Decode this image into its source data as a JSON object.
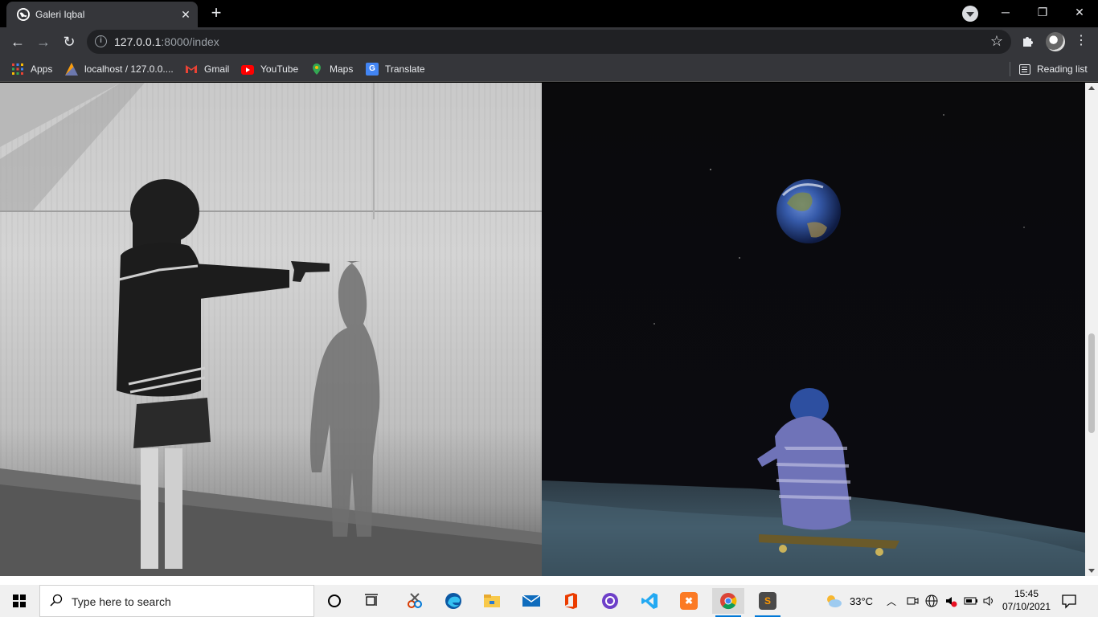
{
  "browser": {
    "tab_title": "Galeri Iqbal",
    "url_host": "127.0.0.1",
    "url_rest": ":8000/index",
    "window_controls": [
      "minimize",
      "restore",
      "close"
    ]
  },
  "bookmarks": {
    "apps": "Apps",
    "items": [
      "localhost / 127.0.0....",
      "Gmail",
      "YouTube",
      "Maps",
      "Translate"
    ],
    "reading_list": "Reading list"
  },
  "page": {
    "images": [
      {
        "name": "girl-with-gun-shadow-photo",
        "tone": "grayscale"
      },
      {
        "name": "boy-on-moon-earth-photo",
        "tone": "color"
      }
    ]
  },
  "taskbar": {
    "search_placeholder": "Type here to search",
    "weather_temp": "33°C",
    "time": "15:45",
    "date": "07/10/2021"
  },
  "colors": {
    "chrome_dark": "#35363a",
    "omnibox": "#202124",
    "taskbar": "#f0f0f0",
    "accent": "#0078d7"
  }
}
